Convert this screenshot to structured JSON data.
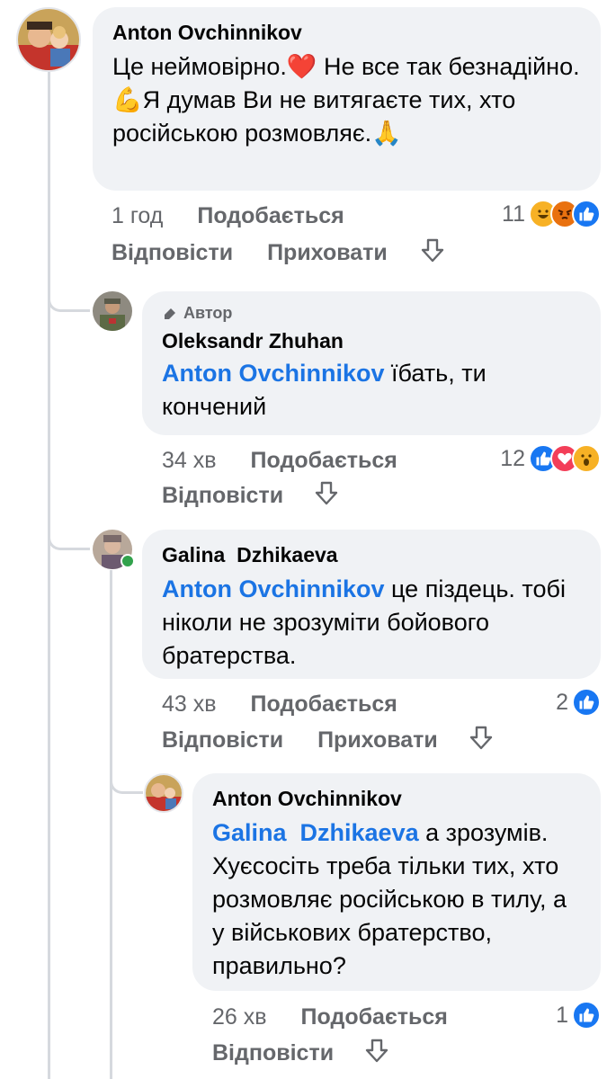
{
  "comments": [
    {
      "author": "Anton Ovchinnikov",
      "text": "Це неймовірно.❤️ Не все так безнадійно. 💪Я думав Ви не витягаєте тих, хто російською розмовляє.🙏",
      "time": "1 год",
      "like_label": "Подобається",
      "reply_label": "Відповісти",
      "hide_label": "Приховати",
      "reaction_count": "11",
      "reactions": [
        "haha",
        "angry",
        "like"
      ]
    },
    {
      "author_tag": "Автор",
      "author": "Oleksandr Zhuhan",
      "mention": "Anton Ovchinnikov",
      "text": " їбать, ти кончений",
      "time": "34 хв",
      "like_label": "Подобається",
      "reply_label": "Відповісти",
      "reaction_count": "12",
      "reactions": [
        "like",
        "love",
        "wow"
      ]
    },
    {
      "author": "Galina  Dzhikaeva",
      "mention": "Anton Ovchinnikov",
      "text": " це піздець. тобі ніколи не зрозуміти бойового братерства.",
      "time": "43 хв",
      "like_label": "Подобається",
      "reply_label": "Відповісти",
      "hide_label": "Приховати",
      "reaction_count": "2",
      "reactions": [
        "like"
      ]
    },
    {
      "author": "Anton Ovchinnikov",
      "mention": "Galina  Dzhikaeva",
      "text": " а зрозумів. Хуєсосіть треба тільки тих, хто розмовляє російською в тилу, а у військових братерство, правильно?",
      "time": "26 хв",
      "like_label": "Подобається",
      "reply_label": "Відповісти",
      "reaction_count": "1",
      "reactions": [
        "like"
      ]
    }
  ],
  "colors": {
    "bubble": "#f0f2f5",
    "mention": "#1b74e4",
    "meta": "#65676b",
    "like_reaction": "#1877f2",
    "love_reaction": "#f33e58",
    "haha_reaction": "#f7b125",
    "angry_reaction": "#e9710f"
  }
}
